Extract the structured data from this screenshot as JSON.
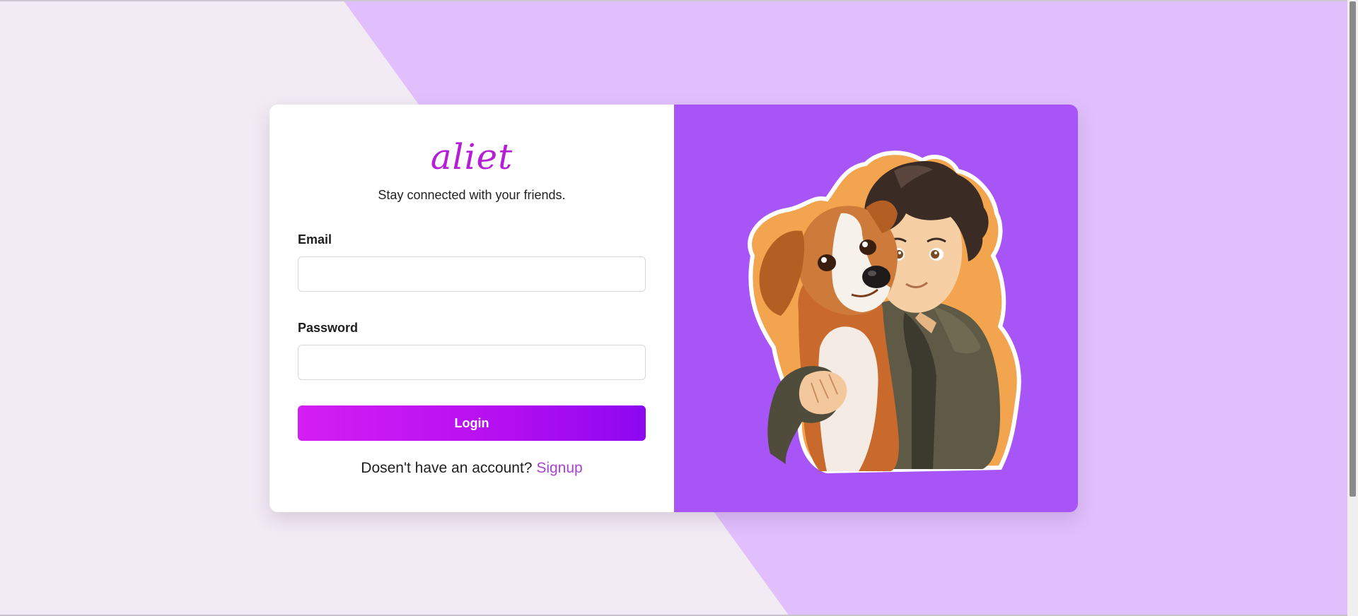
{
  "app": {
    "logo_text": "aliet",
    "tagline": "Stay connected with your friends."
  },
  "form": {
    "email_label": "Email",
    "email_value": "",
    "password_label": "Password",
    "password_value": "",
    "login_label": "Login",
    "signup_prompt": "Dosen't have an account?",
    "signup_link": "Signup"
  },
  "illustration": {
    "icon": "boy-hugging-dog-illustration"
  },
  "colors": {
    "page_bg": "#f2ebf3",
    "diagonal_bg": "#e1bffc",
    "art_panel": "#a855f7",
    "brand": "#b51ed6",
    "button_start": "#d31ff3",
    "button_end": "#8b08f0",
    "link": "#a843d3"
  }
}
